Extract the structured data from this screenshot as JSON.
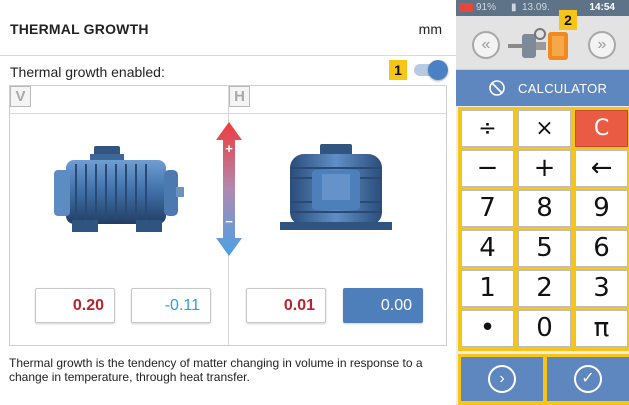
{
  "header": {
    "title": "THERMAL GROWTH",
    "unit": "mm"
  },
  "toggle_row": {
    "label": "Thermal growth enabled:",
    "enabled": true
  },
  "callouts": {
    "first": "1",
    "second": "2"
  },
  "views": {
    "left_letter": "V",
    "right_letter": "H"
  },
  "arrow": {
    "plus": "+",
    "minus": "−"
  },
  "values": {
    "v_left": "0.20",
    "v_right": "-0.11",
    "h_left": "0.01",
    "h_right": "0.00"
  },
  "description": "Thermal growth is the tendency of matter changing in volume in response to a change in temperature, through heat transfer.",
  "status_bar": {
    "battery": "91%",
    "date": "13.09.",
    "time": "14:54"
  },
  "calculator": {
    "title": "CALCULATOR",
    "keys": [
      "÷",
      "×",
      "C",
      "−",
      "+",
      "←",
      "7",
      "8",
      "9",
      "4",
      "5",
      "6",
      "1",
      "2",
      "3",
      "•",
      "0",
      "π"
    ]
  },
  "colors": {
    "accent_blue": "#5e87bf",
    "highlight_yellow": "#f6c516",
    "clear_red": "#ea5b43",
    "value_red": "#b3262d",
    "value_blue": "#2b9fd8"
  },
  "icons": {
    "nav_back": "chevron-left-icon",
    "nav_forward": "chevron-right-icon",
    "next": "chevron-right-circle-icon",
    "confirm": "check-circle-icon"
  }
}
